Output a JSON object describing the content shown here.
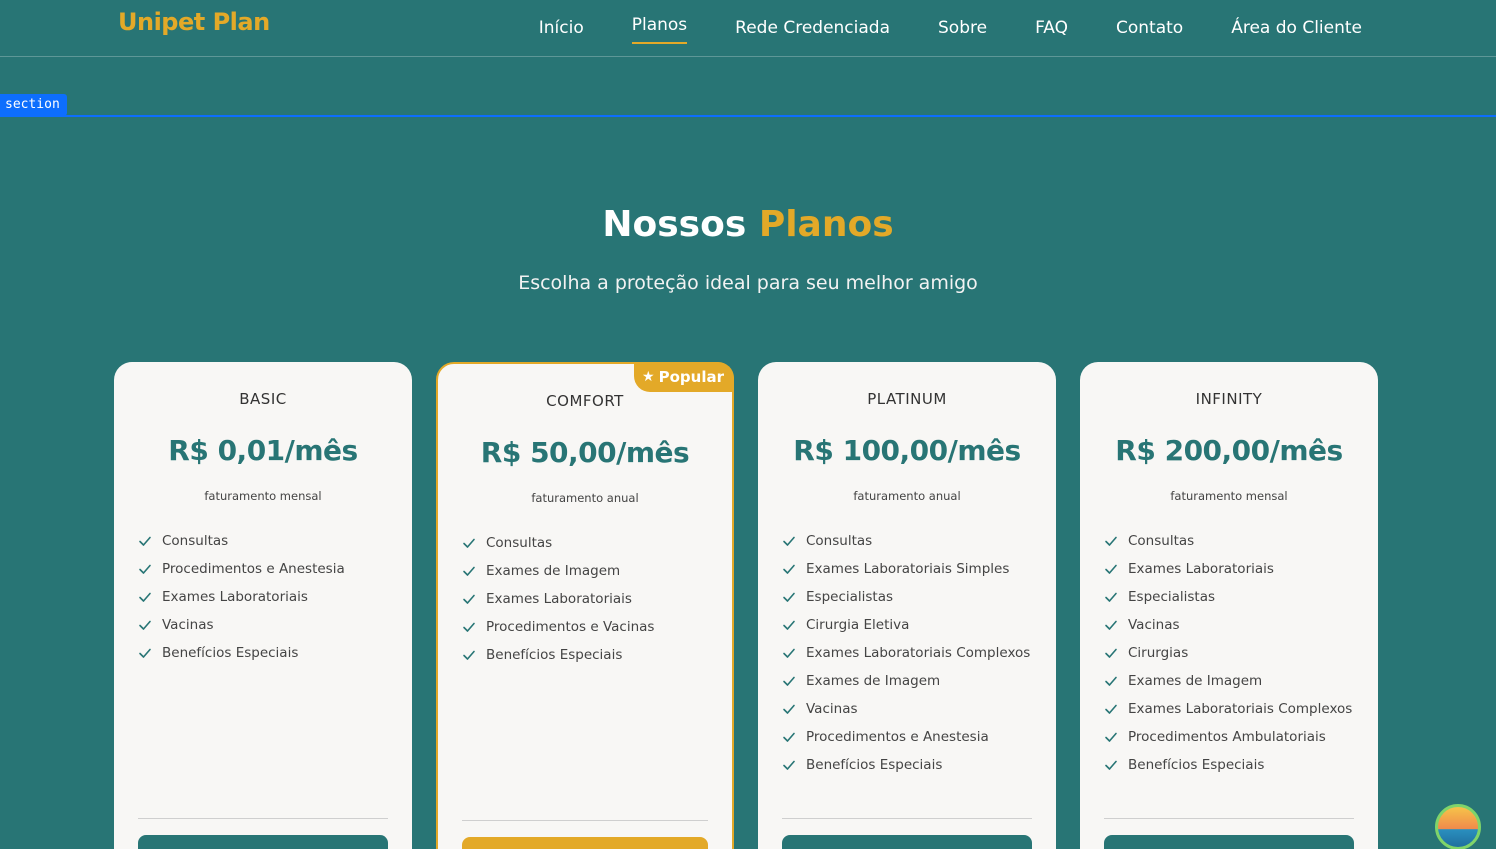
{
  "header": {
    "logo": "Unipet Plan",
    "nav": [
      {
        "label": "Início",
        "active": false
      },
      {
        "label": "Planos",
        "active": true
      },
      {
        "label": "Rede Credenciada",
        "active": false
      },
      {
        "label": "Sobre",
        "active": false
      },
      {
        "label": "FAQ",
        "active": false
      },
      {
        "label": "Contato",
        "active": false
      },
      {
        "label": "Área do Cliente",
        "active": false
      }
    ]
  },
  "debug": {
    "section_tag": "section"
  },
  "hero": {
    "title_part1": "Nossos",
    "title_part2": "Planos",
    "subtitle": "Escolha a proteção ideal para seu melhor amigo"
  },
  "plans": [
    {
      "name": "BASIC",
      "price": "R$ 0,01/mês",
      "billing": "faturamento mensal",
      "popular": false,
      "features": [
        "Consultas",
        "Procedimentos e Anestesia",
        "Exames Laboratoriais",
        "Vacinas",
        "Benefícios Especiais"
      ]
    },
    {
      "name": "COMFORT",
      "price": "R$ 50,00/mês",
      "billing": "faturamento anual",
      "popular": true,
      "badge": "Popular",
      "features": [
        "Consultas",
        "Exames de Imagem",
        "Exames Laboratoriais",
        "Procedimentos e Vacinas",
        "Benefícios Especiais"
      ]
    },
    {
      "name": "PLATINUM",
      "price": "R$ 100,00/mês",
      "billing": "faturamento anual",
      "popular": false,
      "features": [
        "Consultas",
        "Exames Laboratoriais Simples",
        "Especialistas",
        "Cirurgia Eletiva",
        "Exames Laboratoriais Complexos",
        "Exames de Imagem",
        "Vacinas",
        "Procedimentos e Anestesia",
        "Benefícios Especiais"
      ]
    },
    {
      "name": "INFINITY",
      "price": "R$ 200,00/mês",
      "billing": "faturamento mensal",
      "popular": false,
      "features": [
        "Consultas",
        "Exames Laboratoriais",
        "Especialistas",
        "Vacinas",
        "Cirurgias",
        "Exames de Imagem",
        "Exames Laboratoriais Complexos",
        "Procedimentos Ambulatoriais",
        "Benefícios Especiais"
      ]
    }
  ],
  "colors": {
    "background": "#287575",
    "accent": "#e3a928",
    "card": "#f8f7f5",
    "price": "#287575"
  },
  "icons": {
    "feature": "check-icon",
    "badge": "star-icon"
  }
}
